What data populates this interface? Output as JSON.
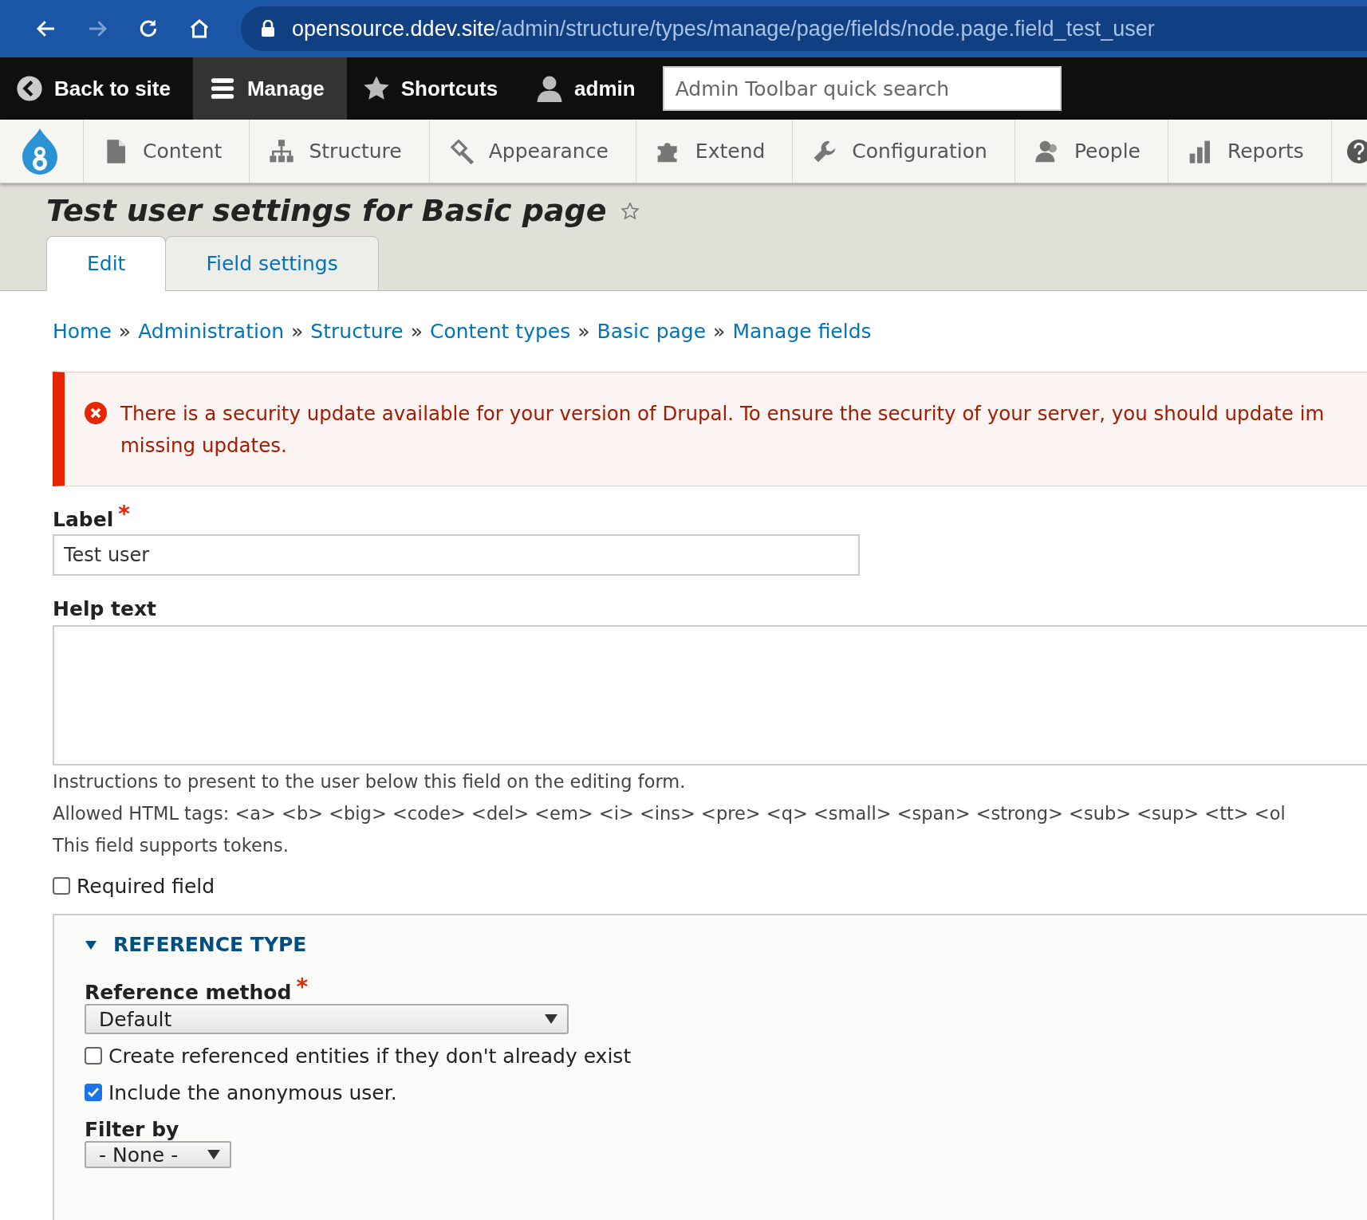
{
  "browser": {
    "nav": [
      {
        "kind": "back",
        "disabled": false
      },
      {
        "kind": "forward",
        "disabled": true
      },
      {
        "kind": "reload",
        "disabled": false
      },
      {
        "kind": "home",
        "disabled": false
      }
    ],
    "url": {
      "host": "opensource.ddev.site",
      "path": "/admin/structure/types/manage/page/fields/node.page.field_test_user"
    }
  },
  "toolbar": {
    "items": [
      {
        "kind": "back",
        "label": "Back to site",
        "selected": false
      },
      {
        "kind": "menu",
        "label": "Manage",
        "selected": true
      },
      {
        "kind": "star",
        "label": "Shortcuts",
        "selected": false
      },
      {
        "kind": "user",
        "label": "admin",
        "selected": false
      }
    ],
    "search": {
      "placeholder": "Admin Toolbar quick search"
    }
  },
  "tray": {
    "items": [
      {
        "kind": "logo"
      },
      {
        "kind": "content",
        "label": "Content"
      },
      {
        "kind": "structure",
        "label": "Structure"
      },
      {
        "kind": "appearance",
        "label": "Appearance"
      },
      {
        "kind": "extend",
        "label": "Extend"
      },
      {
        "kind": "configuration",
        "label": "Configuration"
      },
      {
        "kind": "people",
        "label": "People"
      },
      {
        "kind": "reports",
        "label": "Reports"
      },
      {
        "kind": "help"
      }
    ]
  },
  "page_title": "Test user settings for Basic page",
  "tabs": [
    {
      "label": "Edit",
      "selected": true
    },
    {
      "label": "Field settings",
      "selected": false
    }
  ],
  "breadcrumb": [
    {
      "label": "Home"
    },
    {
      "separator": "»",
      "label": "Administration"
    },
    {
      "separator": "»",
      "label": "Structure"
    },
    {
      "separator": "»",
      "label": "Content types"
    },
    {
      "separator": "»",
      "label": "Basic page"
    },
    {
      "separator": "»",
      "label": "Manage fields"
    }
  ],
  "message": {
    "kind": "error",
    "lines": [
      "There is a security update available for your version of Drupal. To ensure the security of your server, you should update im",
      "missing updates."
    ]
  },
  "form": {
    "label_field": {
      "label": "Label",
      "required_mark": "*",
      "value": "Test user"
    },
    "help_text": {
      "label": "Help text",
      "descriptions": [
        "Instructions to present to the user below this field on the editing form.",
        "Allowed HTML tags: <a> <b> <big> <code> <del> <em> <i> <ins> <pre> <q> <small> <span> <strong> <sub> <sup> <tt> <ol",
        "This field supports tokens."
      ]
    },
    "required_field": {
      "label": "Required field",
      "checked": false
    },
    "fieldset": {
      "title": "REFERENCE TYPE",
      "expanded": true,
      "method": {
        "label": "Reference method",
        "required_mark": "*",
        "value": "Default"
      },
      "checkboxes": [
        {
          "label": "Create referenced entities if they don't already exist",
          "checked": false
        },
        {
          "label": "Include the anonymous user.",
          "checked": true
        }
      ],
      "filter": {
        "label": "Filter by",
        "value": "- None -"
      }
    }
  }
}
